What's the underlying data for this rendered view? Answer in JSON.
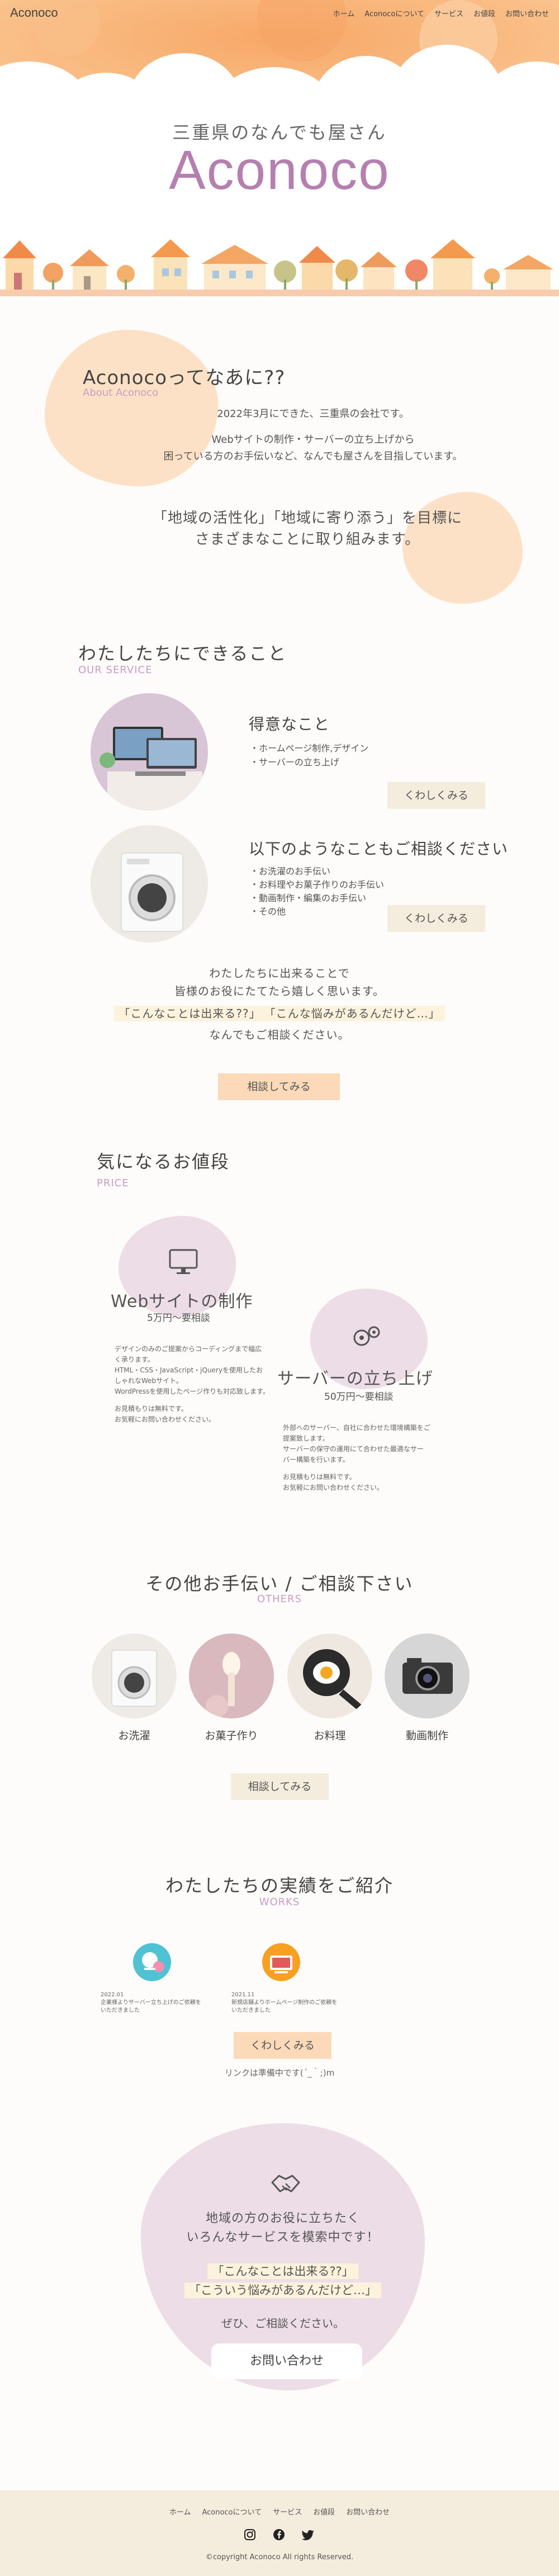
{
  "header": {
    "logo": "Aconoco",
    "nav": [
      "ホーム",
      "Aconocoについて",
      "サービス",
      "お値段",
      "お問い合わせ"
    ]
  },
  "hero": {
    "subtitle": "三重県のなんでも屋さん",
    "title": "Aconoco"
  },
  "about": {
    "title": "Aconocoってなあに??",
    "en": "About Aconoco",
    "line1": "2022年3月にできた、三重県の会社です。",
    "line2": "Webサイトの制作・サーバーの立ち上げから",
    "line3": "困っている方のお手伝いなど、なんでも屋さんを目指しています。",
    "line4": "「地域の活性化」「地域に寄り添う」を目標に",
    "line5": "さまざまなことに取り組みます。"
  },
  "service": {
    "title": "わたしたちにできること",
    "en": "OUR SERVICE",
    "item1": {
      "title": "得意なこと",
      "points": [
        "・ホームページ制作,デザイン",
        "・サーバーの立ち上げ"
      ],
      "button": "くわしくみる"
    },
    "item2": {
      "title": "以下のようなこともご相談ください",
      "points": [
        "・お洗濯のお手伝い",
        "・お料理やお菓子作りのお手伝い",
        "・動画制作・編集のお手伝い",
        "・その他"
      ],
      "button": "くわしくみる"
    },
    "msg1": "わたしたちに出来ることで",
    "msg2": "皆様のお役にたてたら嬉しく思います。",
    "msg3a": "「こんなことは出来る??」",
    "msg3b": "「こんな悩みがあるんだけど…」",
    "msg4": "なんでもご相談ください。",
    "button": "相談してみる"
  },
  "price": {
    "title": "気になるお値段",
    "en": "PRICE",
    "web": {
      "title": "Webサイトの制作",
      "price": "5万円〜要相談",
      "desc": [
        "デザインのみのご提案からコーディングまで幅広",
        "く承ります。",
        "HTML・CSS・JavaScript・jQueryを使用したお",
        "しゃれなWebサイト。",
        "WordPressを使用したページ作りも対応致します。",
        "",
        "お見積もりは無料です。",
        "お気軽にお問い合わせください。"
      ]
    },
    "server": {
      "title": "サーバーの立ち上げ",
      "price": "50万円〜要相談",
      "desc": [
        "外部へのサーバー、自社に合わせた環境構築をご",
        "提案致します。",
        "サーバーの保守の運用にて合わせた最適なサー",
        "バー構築を行います。",
        "",
        "お見積もりは無料です。",
        "お気軽にお問い合わせください。"
      ]
    }
  },
  "others": {
    "title": "その他お手伝い / ご相談下さい",
    "en": "OTHERS",
    "items": [
      "お洗濯",
      "お菓子作り",
      "お料理",
      "動画制作"
    ],
    "button": "相談してみる"
  },
  "works": {
    "title": "わたしたちの実績をご紹介",
    "en": "WORKS",
    "item1": [
      "2022.01",
      "企業様よりサーバー立ち上げのご依頼を",
      "いただきました"
    ],
    "item2": [
      "2021.11",
      "新規店舗よりホームページ制作のご依頼を",
      "いただきました"
    ],
    "button": "くわしくみる",
    "note": "リンクは準備中です(´_｀;)m"
  },
  "contact": {
    "line1": "地域の方のお役に立ちたく",
    "line2": "いろんなサービスを模索中です！",
    "q1": "「こんなことは出来る??」",
    "q2": "「こういう悩みがあるんだけど…」",
    "line3": "ぜひ、ご相談ください。",
    "button": "お問い合わせ"
  },
  "footer": {
    "nav": [
      "ホーム",
      "Aconocoについて",
      "サービス",
      "お値段",
      "お問い合わせ"
    ],
    "copyright": "©copyright Aconoco All rights Reserved."
  }
}
